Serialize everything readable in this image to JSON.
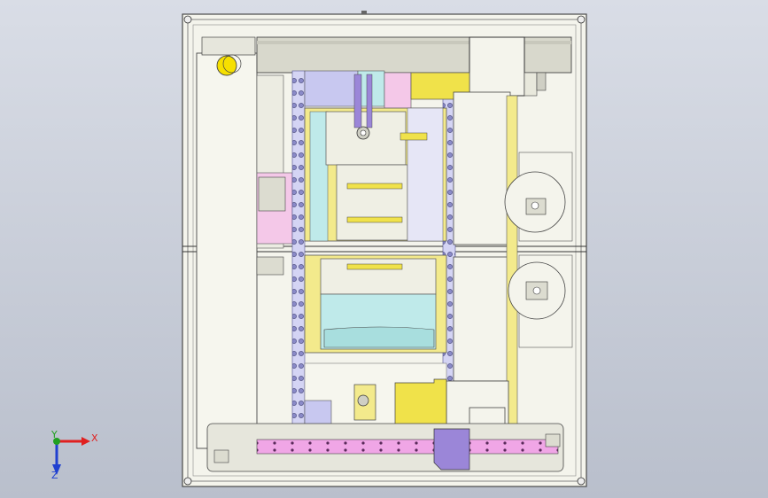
{
  "viewport": {
    "background_top": "#d9dde6",
    "background_bottom": "#b9bfcc"
  },
  "colors": {
    "frame": "#f4f4ec",
    "frame_stroke": "#4a4a4a",
    "yellow": "#f3ea8c",
    "yellow_bright": "#f0e24a",
    "cyan": "#bfeaea",
    "magenta": "#f0a6e6",
    "lavender": "#c8c8f0",
    "purple": "#9b86d8",
    "pink": "#f4c8e8",
    "grey": "#cfcfc4",
    "label_yellow": "#f6e000"
  },
  "triad": {
    "x_label": "X",
    "y_label": "Y",
    "z_label": "Z",
    "x_color": "#e02020",
    "y_color": "#20a020",
    "z_color": "#2040d0"
  }
}
